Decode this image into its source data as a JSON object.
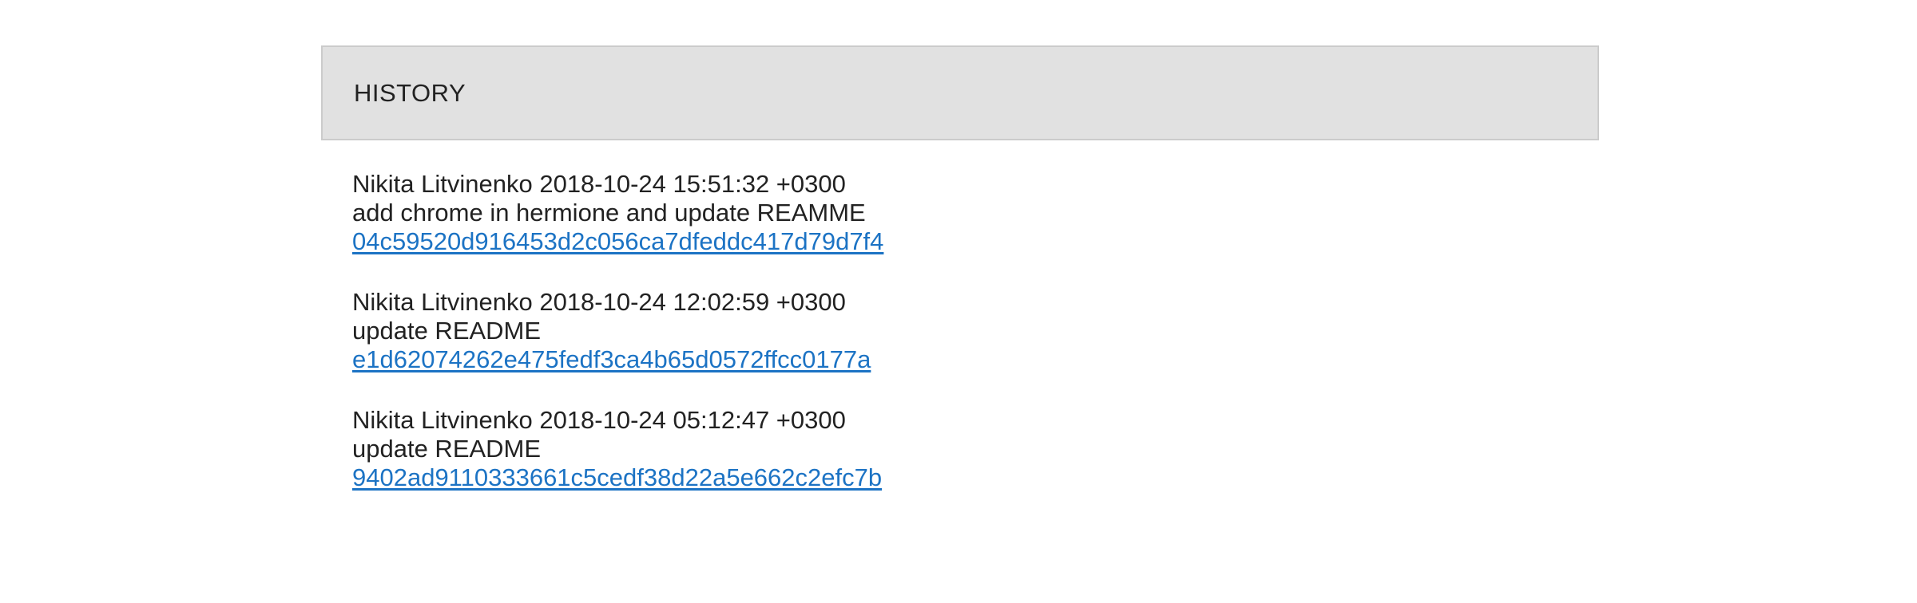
{
  "history": {
    "title": "HISTORY",
    "commits": [
      {
        "meta": "Nikita Litvinenko 2018-10-24 15:51:32 +0300",
        "message": "add chrome in hermione and update REAMME",
        "hash": "04c59520d916453d2c056ca7dfeddc417d79d7f4"
      },
      {
        "meta": "Nikita Litvinenko 2018-10-24 12:02:59 +0300",
        "message": "update README",
        "hash": "e1d62074262e475fedf3ca4b65d0572ffcc0177a"
      },
      {
        "meta": "Nikita Litvinenko 2018-10-24 05:12:47 +0300",
        "message": "update README",
        "hash": "9402ad9110333661c5cedf38d22a5e662c2efc7b"
      }
    ]
  },
  "colors": {
    "header_background": "#e1e1e1",
    "link": "#1c73c4",
    "text": "#222222"
  }
}
